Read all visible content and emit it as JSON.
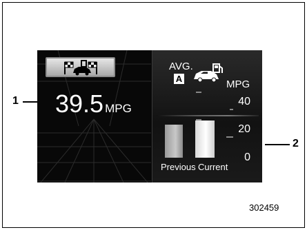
{
  "trip": {
    "value": "39.5",
    "unit": "MPG",
    "icon": "trip-car-flags-icon"
  },
  "average": {
    "label": "AVG.",
    "mode_badge": "A",
    "unit": "MPG",
    "icon": "car-fuel-pump-icon"
  },
  "chart_data": {
    "type": "bar",
    "categories": [
      "Previous",
      "Current"
    ],
    "values": [
      24,
      27
    ],
    "ylim": [
      0,
      40
    ],
    "ytick_labels": [
      "40",
      "20",
      "0"
    ],
    "grid": false,
    "colors": [
      "#b4b4b4",
      "#f2f2f2"
    ]
  },
  "callouts": {
    "trip": "1",
    "chart": "2"
  },
  "figure_id": "302459"
}
